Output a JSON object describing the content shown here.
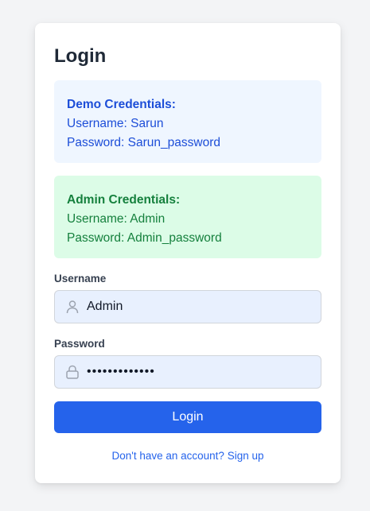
{
  "login": {
    "title": "Login",
    "demo_credentials": {
      "heading": "Demo Credentials:",
      "username_line": "Username: Sarun",
      "password_line": "Password: Sarun_password"
    },
    "admin_credentials": {
      "heading": "Admin Credentials:",
      "username_line": "Username: Admin",
      "password_line": "Password: Admin_password"
    },
    "username": {
      "label": "Username",
      "value": "Admin",
      "icon": "user-icon"
    },
    "password": {
      "label": "Password",
      "value": "Admin_passwor",
      "icon": "lock-icon"
    },
    "submit_label": "Login",
    "signup_link": "Don't have an account? Sign up"
  },
  "colors": {
    "page_background": "#f3f4f6",
    "primary": "#2563eb",
    "demo_box_background": "#eff6ff",
    "demo_box_text": "#1d4ed8",
    "admin_box_background": "#dcfce7",
    "admin_box_text": "#15803d",
    "input_background": "#e8f0fe"
  }
}
